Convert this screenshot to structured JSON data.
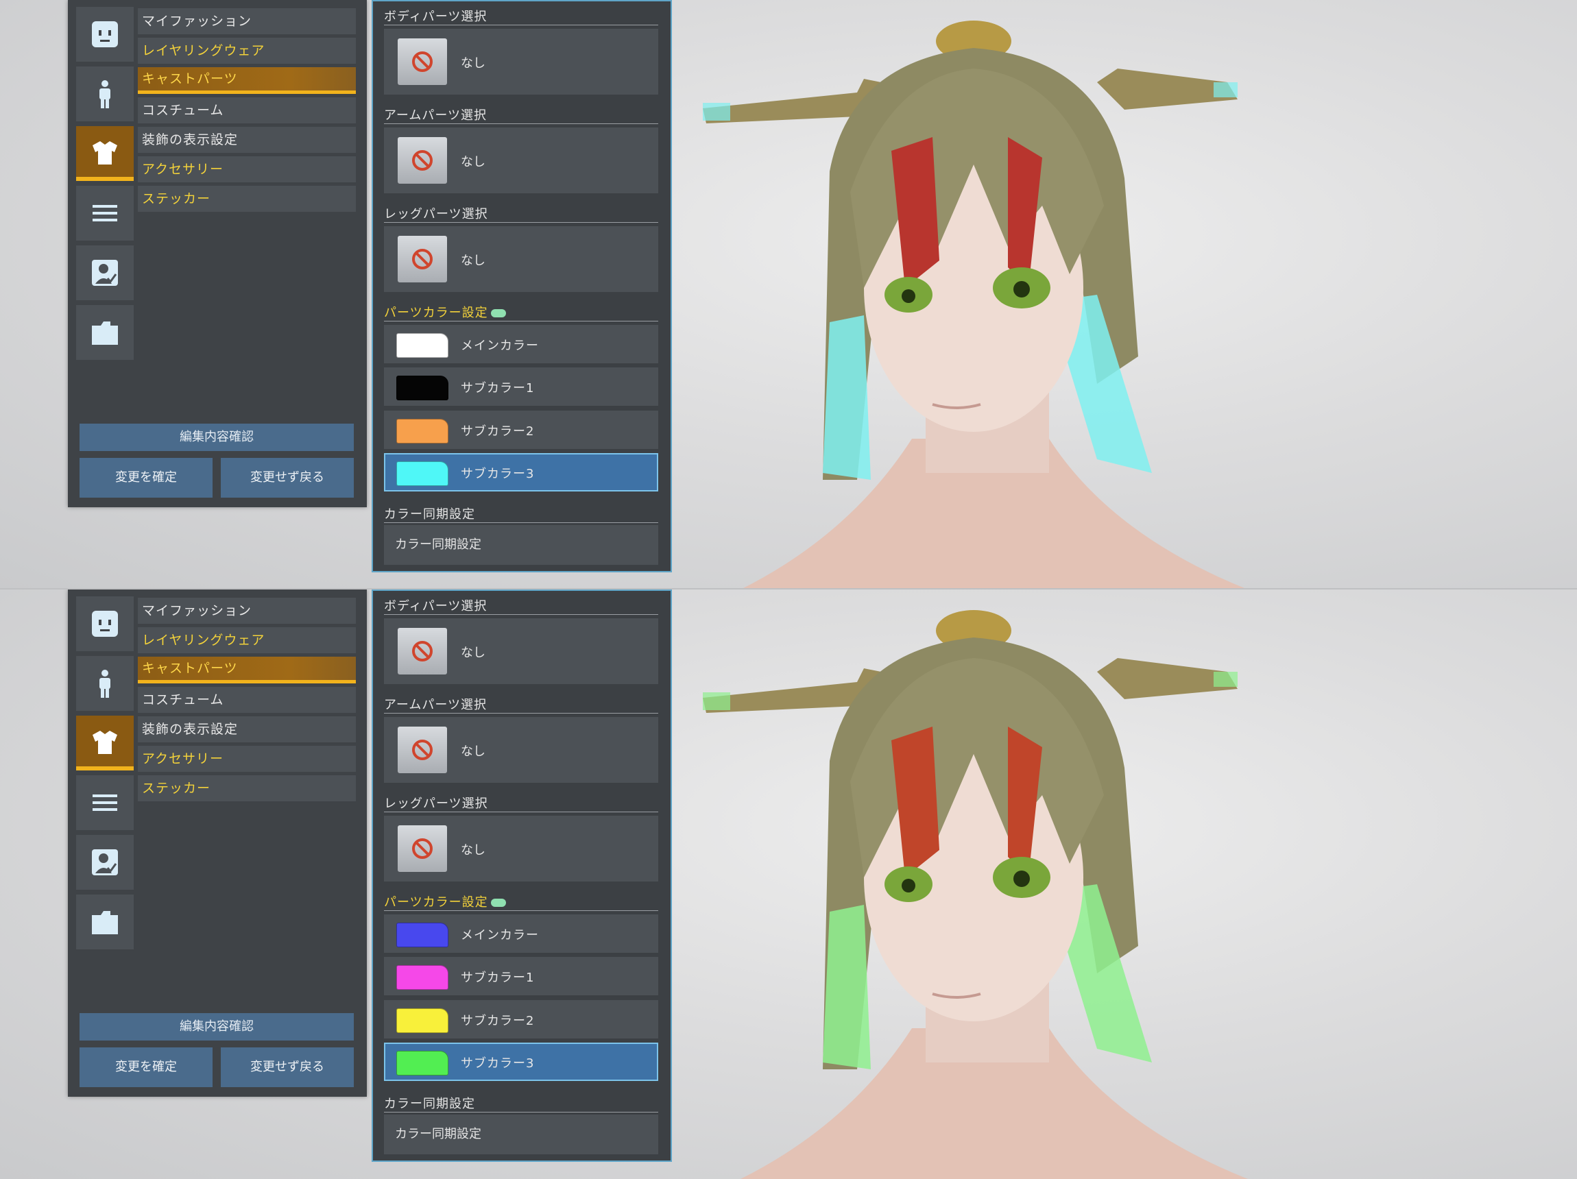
{
  "menu": {
    "items": [
      {
        "label": "マイファッション",
        "style": "normal"
      },
      {
        "label": "レイヤリングウェア",
        "style": "yellow"
      },
      {
        "label": "キャストパーツ",
        "style": "active"
      },
      {
        "label": "コスチューム",
        "style": "normal"
      },
      {
        "label": "装飾の表示設定",
        "style": "normal"
      },
      {
        "label": "アクセサリー",
        "style": "yellow"
      },
      {
        "label": "ステッカー",
        "style": "yellow"
      }
    ],
    "icons": [
      "face-icon",
      "body-icon",
      "shirt-icon",
      "list-icon",
      "profile-icon",
      "folder-icon"
    ],
    "confirm_label": "編集内容確認",
    "apply_label": "変更を確定",
    "cancel_label": "変更せず戻る"
  },
  "parts": {
    "body_title": "ボディパーツ選択",
    "body_value": "なし",
    "arm_title": "アームパーツ選択",
    "arm_value": "なし",
    "leg_title": "レッグパーツ選択",
    "leg_value": "なし",
    "color_title": "パーツカラー設定",
    "sync_title": "カラー同期設定",
    "sync_label": "カラー同期設定"
  },
  "views": [
    {
      "colors": [
        {
          "label": "メインカラー",
          "hex": "#ffffff"
        },
        {
          "label": "サブカラー1",
          "hex": "#050505"
        },
        {
          "label": "サブカラー2",
          "hex": "#f7a04c"
        },
        {
          "label": "サブカラー3",
          "hex": "#4ff7f7"
        }
      ],
      "accent": "#7ff0f0"
    },
    {
      "colors": [
        {
          "label": "メインカラー",
          "hex": "#4848ee"
        },
        {
          "label": "サブカラー1",
          "hex": "#f548e8"
        },
        {
          "label": "サブカラー2",
          "hex": "#f8f03a"
        },
        {
          "label": "サブカラー3",
          "hex": "#52ee52"
        }
      ],
      "accent": "#8ff08f"
    }
  ],
  "selected_color_index": 3
}
